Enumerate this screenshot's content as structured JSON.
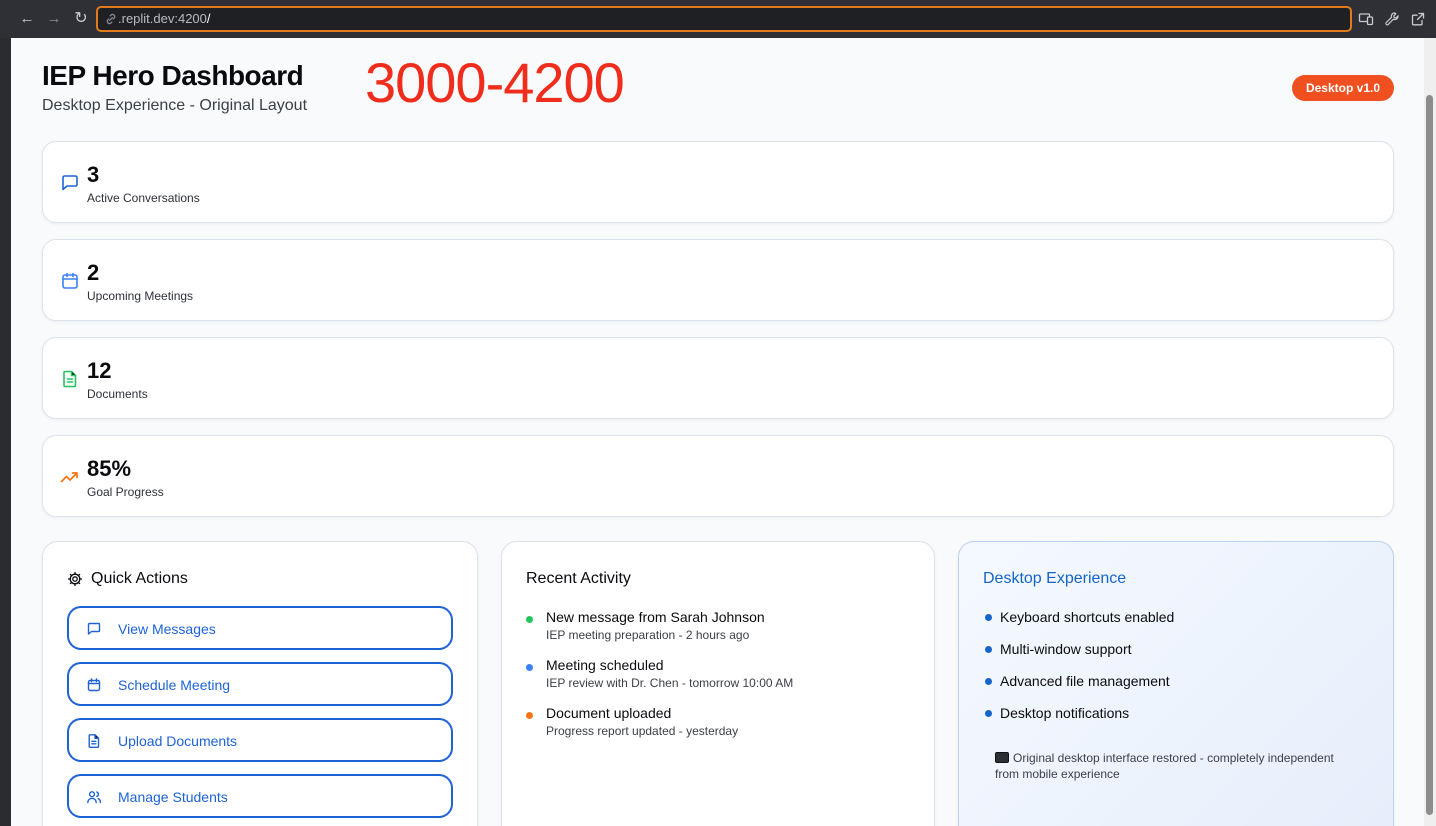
{
  "browser": {
    "url_prefix": ".replit.dev:4200",
    "url_suffix": "/"
  },
  "header": {
    "title": "IEP Hero Dashboard",
    "subtitle": "Desktop Experience - Original Layout",
    "port_range": "3000-4200",
    "version_badge": "Desktop v1.0"
  },
  "stats": [
    {
      "value": "3",
      "label": "Active Conversations",
      "icon": "message-icon",
      "color": "#1e63d6"
    },
    {
      "value": "2",
      "label": "Upcoming Meetings",
      "icon": "calendar-icon",
      "color": "#3b82f6"
    },
    {
      "value": "12",
      "label": "Documents",
      "icon": "document-icon",
      "color": "#22c55e"
    },
    {
      "value": "85%",
      "label": "Goal Progress",
      "icon": "trending-up-icon",
      "color": "#f97316"
    }
  ],
  "quick_actions": {
    "title": "Quick Actions",
    "items": [
      {
        "label": "View Messages",
        "icon": "message-icon"
      },
      {
        "label": "Schedule Meeting",
        "icon": "calendar-icon"
      },
      {
        "label": "Upload Documents",
        "icon": "document-icon"
      },
      {
        "label": "Manage Students",
        "icon": "users-icon"
      }
    ]
  },
  "recent_activity": {
    "title": "Recent Activity",
    "items": [
      {
        "title": "New message from Sarah Johnson",
        "detail": "IEP meeting preparation - 2 hours ago",
        "dot_color": "#22c55e"
      },
      {
        "title": "Meeting scheduled",
        "detail": "IEP review with Dr. Chen - tomorrow 10:00 AM",
        "dot_color": "#3b82f6"
      },
      {
        "title": "Document uploaded",
        "detail": "Progress report updated - yesterday",
        "dot_color": "#f97316"
      }
    ]
  },
  "desktop_experience": {
    "title": "Desktop Experience",
    "features": [
      "Keyboard shortcuts enabled",
      "Multi-window support",
      "Advanced file management",
      "Desktop notifications"
    ],
    "note": "Original desktop interface restored - completely independent from mobile experience"
  },
  "colors": {
    "accent": "#1e63d6",
    "badge": "#f0501f",
    "port_text": "#f02d1c"
  }
}
